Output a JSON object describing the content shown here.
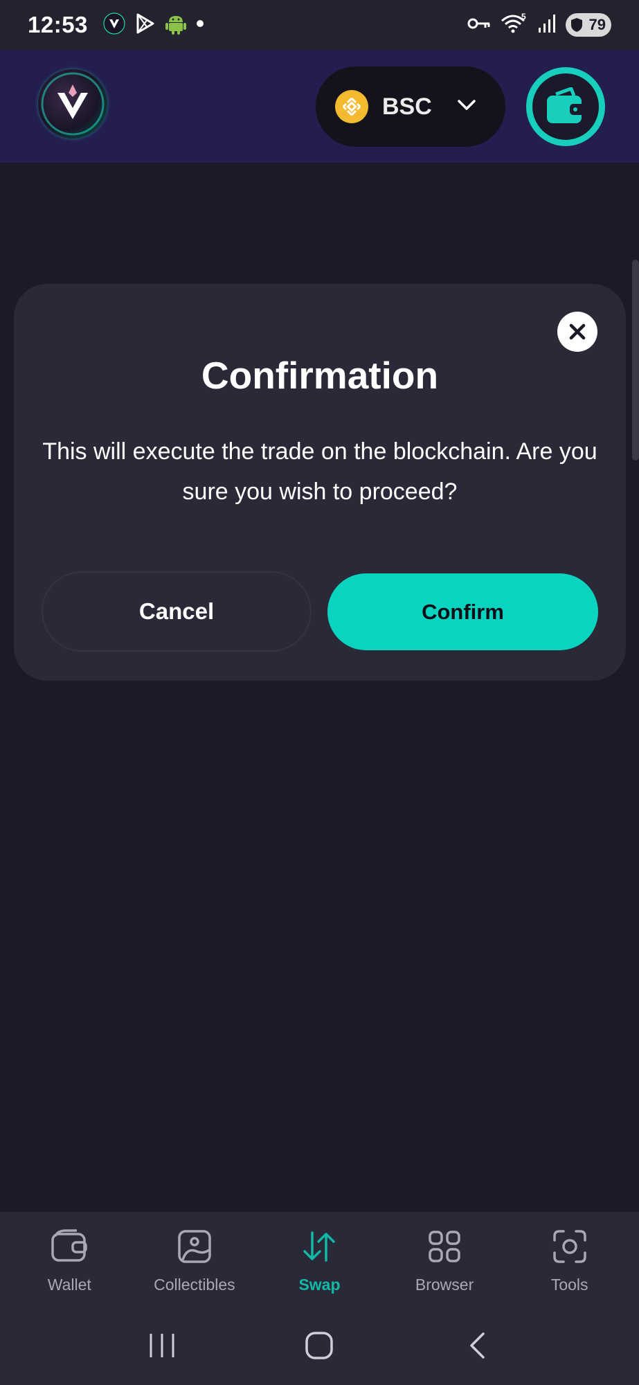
{
  "status_bar": {
    "time": "12:53",
    "battery": "79",
    "network_badge": "5"
  },
  "header": {
    "network": {
      "label": "BSC",
      "icon": "bnb-icon",
      "color": "#f3ba2f"
    },
    "wallet_icon": "wallet-icon",
    "accent_color": "#18cfbe",
    "background_color": "#241d4f"
  },
  "modal": {
    "title": "Confirmation",
    "message": "This will execute the trade on the blockchain. Are you sure you wish to proceed?",
    "cancel_label": "Cancel",
    "confirm_label": "Confirm",
    "close_icon": "close-icon",
    "confirm_color": "#0ad3bf"
  },
  "bottom_nav": {
    "items": [
      {
        "label": "Wallet",
        "icon": "wallet-icon",
        "active": false
      },
      {
        "label": "Collectibles",
        "icon": "image-icon",
        "active": false
      },
      {
        "label": "Swap",
        "icon": "swap-arrows-icon",
        "active": true
      },
      {
        "label": "Browser",
        "icon": "grid-icon",
        "active": false
      },
      {
        "label": "Tools",
        "icon": "scan-icon",
        "active": false
      }
    ],
    "active_color": "#12b8a6"
  },
  "system_nav": {
    "recents_icon": "recents-icon",
    "home_icon": "home-icon",
    "back_icon": "back-icon"
  }
}
